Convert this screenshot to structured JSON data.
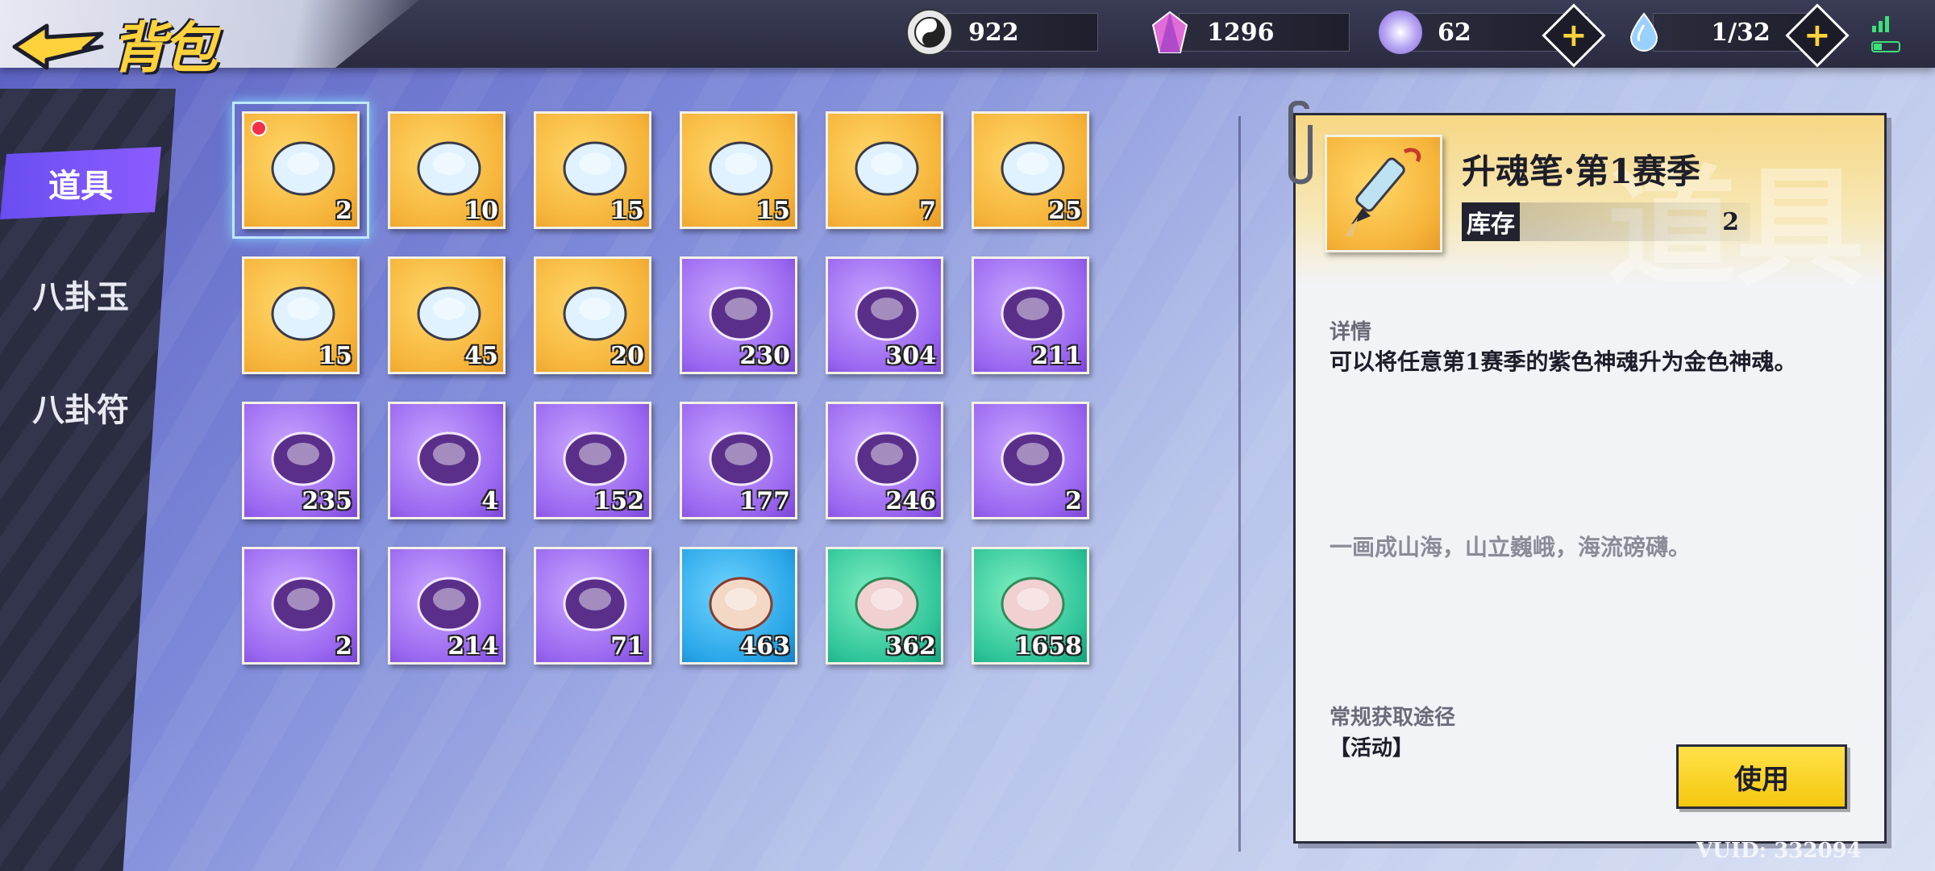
{
  "header": {
    "title": "背包",
    "resources": [
      {
        "icon": "yin-yang-icon",
        "value": "922"
      },
      {
        "icon": "crystal-icon",
        "value": "1296"
      },
      {
        "icon": "spirit-orb-icon",
        "value": "62"
      },
      {
        "icon": "water-drop-icon",
        "value": "1/32"
      }
    ]
  },
  "nav": {
    "items": [
      {
        "label": "道具",
        "active": true
      },
      {
        "label": "八卦玉",
        "active": false
      },
      {
        "label": "八卦符",
        "active": false
      }
    ]
  },
  "items": [
    {
      "count": "2",
      "rarity": "gold",
      "icon": "brush-icon",
      "selected": true,
      "new": true
    },
    {
      "count": "10",
      "rarity": "gold",
      "icon": "ink-pot-gray-icon"
    },
    {
      "count": "15",
      "rarity": "gold",
      "icon": "ink-pot-gold-icon"
    },
    {
      "count": "15",
      "rarity": "gold",
      "icon": "ink-pot-green-icon"
    },
    {
      "count": "7",
      "rarity": "gold",
      "icon": "ink-pot-red-icon"
    },
    {
      "count": "25",
      "rarity": "gold",
      "icon": "ink-pot-blue-icon"
    },
    {
      "count": "15",
      "rarity": "gold",
      "icon": "ink-pot-brown-icon"
    },
    {
      "count": "45",
      "rarity": "gold",
      "icon": "ink-pot-cyan-icon"
    },
    {
      "count": "20",
      "rarity": "gold",
      "icon": "ink-pot-purple-icon"
    },
    {
      "count": "230",
      "rarity": "purple",
      "icon": "dark-crystal-icon"
    },
    {
      "count": "304",
      "rarity": "purple",
      "icon": "feather-icon"
    },
    {
      "count": "211",
      "rarity": "purple",
      "icon": "antler-icon"
    },
    {
      "count": "235",
      "rarity": "purple",
      "icon": "ice-crystal-icon"
    },
    {
      "count": "4",
      "rarity": "purple",
      "icon": "seed-icon"
    },
    {
      "count": "152",
      "rarity": "purple",
      "icon": "jade-disc-icon"
    },
    {
      "count": "177",
      "rarity": "purple",
      "icon": "stone-horseshoe-icon"
    },
    {
      "count": "246",
      "rarity": "purple",
      "icon": "fang-necklace-icon"
    },
    {
      "count": "2",
      "rarity": "purple",
      "icon": "log-icon"
    },
    {
      "count": "2",
      "rarity": "purple",
      "icon": "record-icon"
    },
    {
      "count": "214",
      "rarity": "purple",
      "icon": "green-gem-icon"
    },
    {
      "count": "71",
      "rarity": "purple",
      "icon": "moss-rock-icon"
    },
    {
      "count": "463",
      "rarity": "blue",
      "icon": "shell-fragment-icon"
    },
    {
      "count": "362",
      "rarity": "green",
      "icon": "horn-shard-icon"
    },
    {
      "count": "1658",
      "rarity": "green",
      "icon": "emerald-shards-icon"
    }
  ],
  "detail": {
    "watermark": "道具",
    "name": "升魂笔·第1赛季",
    "stock_label": "库存",
    "stock_value": "2",
    "details_label": "详情",
    "description": "可以将任意第1赛季的紫色神魂升为金色神魂。",
    "flavor": "一画成山海，山立巍峨，海流磅礴。",
    "source_label": "常规获取途径",
    "source_value": "【活动】",
    "use_button": "使用"
  },
  "footer": {
    "vuid": "VUID: 332094"
  },
  "colors": {
    "accent_gold": "#ffd23c",
    "nav_active": "#7a55f5",
    "rarity_gold": "#f6b43a",
    "rarity_purple": "#9a67f0",
    "rarity_blue": "#2aa6e8",
    "rarity_green": "#2fc49a"
  }
}
